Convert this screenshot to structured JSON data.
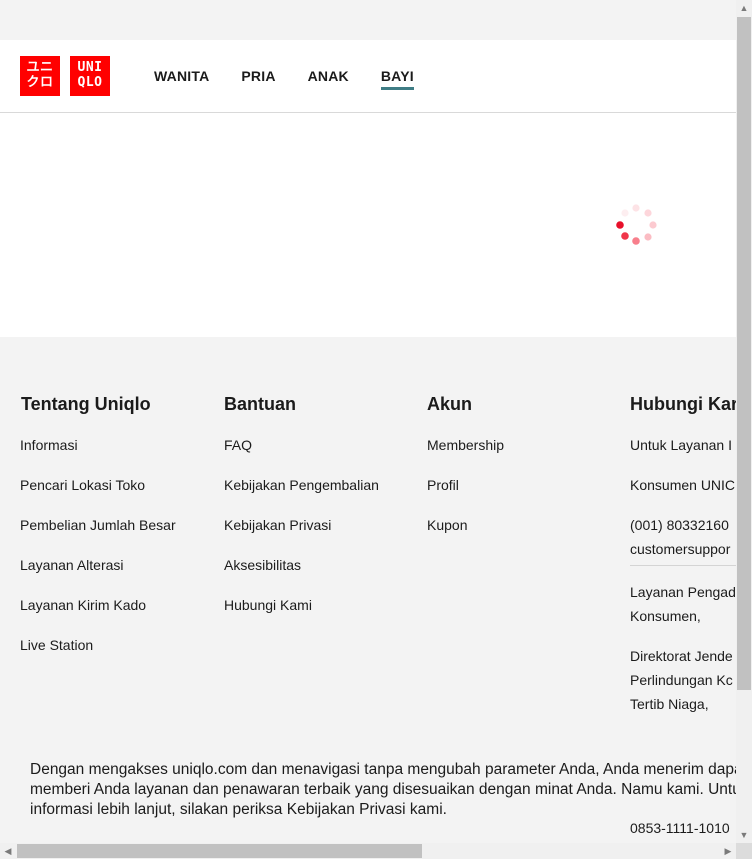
{
  "header": {
    "logo_katakana": [
      "ユニ",
      "クロ"
    ],
    "logo_latin": [
      "UNI",
      "QLO"
    ],
    "nav": [
      {
        "label": "WANITA",
        "active": false
      },
      {
        "label": "PRIA",
        "active": false
      },
      {
        "label": "ANAK",
        "active": false
      },
      {
        "label": "BAYI",
        "active": true
      }
    ],
    "brand_color": "#ff0000",
    "active_underline_color": "#3f7d85"
  },
  "content": {
    "loading_icon": "loading-spinner-icon"
  },
  "footer": {
    "columns": [
      {
        "title": "Tentang Uniqlo",
        "links": [
          "Informasi",
          "Pencari Lokasi Toko",
          "Pembelian Jumlah Besar",
          "Layanan Alterasi",
          "Layanan Kirim Kado",
          "Live Station"
        ]
      },
      {
        "title": "Bantuan",
        "links": [
          "FAQ",
          "Kebijakan Pengembalian",
          "Kebijakan Privasi",
          "Aksesibilitas",
          "Hubungi Kami"
        ]
      },
      {
        "title": "Akun",
        "links": [
          "Membership",
          "Profil",
          "Kupon"
        ]
      }
    ],
    "contact": {
      "title": "Hubungi Kar",
      "line1": "Untuk Layanan I",
      "line2": "Konsumen UNIC",
      "line3": "(001) 80332160",
      "line4": "customersuppor",
      "line5": "Layanan Pengad",
      "line6": "Konsumen,",
      "line7": "Direktorat Jende",
      "line8": "Perlindungan Kc",
      "line9": "Tertib Niaga,",
      "phone_partial": "0853-1111-1010"
    }
  },
  "cookie_notice": {
    "text": "Dengan mengakses uniqlo.com dan menavigasi tanpa mengubah parameter Anda, Anda menerim dapat memberi Anda layanan dan penawaran terbaik yang disesuaikan dengan minat Anda. Namu kami. Untuk informasi lebih lanjut, silakan periksa Kebijakan Privasi kami."
  }
}
